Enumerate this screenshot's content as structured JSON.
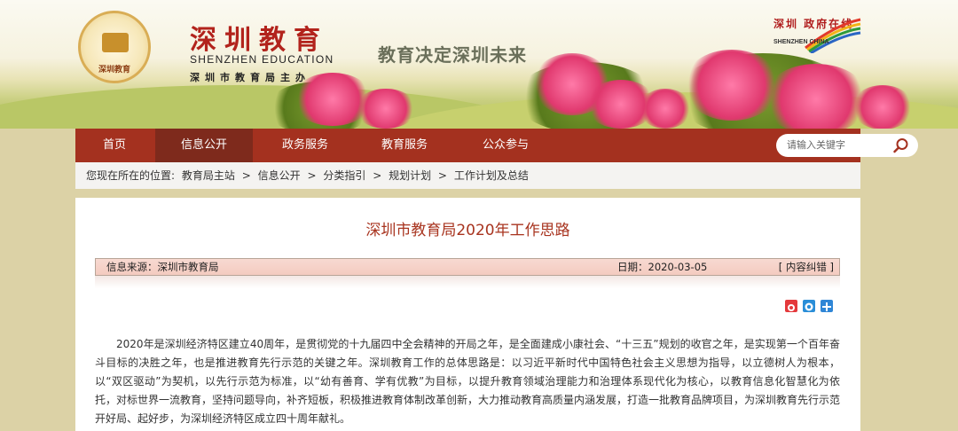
{
  "header": {
    "seal_text": "深圳教育",
    "brand_cn": "深圳教育",
    "brand_en": "SHENZHEN EDUCATION",
    "brand_sub": "深圳市教育局主办",
    "slogan": "教育决定深圳未来",
    "china_cn": "深圳 政府在线",
    "china_en": "SHENZHEN CHINA"
  },
  "nav": {
    "items": [
      {
        "label": "首页",
        "active": false
      },
      {
        "label": "信息公开",
        "active": true
      },
      {
        "label": "政务服务",
        "active": false
      },
      {
        "label": "教育服务",
        "active": false
      },
      {
        "label": "公众参与",
        "active": false
      }
    ],
    "search_placeholder": "请输入关键字"
  },
  "breadcrumb": {
    "prefix": "您现在所在的位置:",
    "items": [
      "教育局主站",
      "信息公开",
      "分类指引",
      "规划计划",
      "工作计划及总结"
    ],
    "separator": ">"
  },
  "article": {
    "title": "深圳市教育局2020年工作思路",
    "source": "信息来源：深圳市教育局",
    "date": "日期：2020-03-05",
    "error_link": "[ 内容纠错 ]",
    "paragraph": "2020年是深圳经济特区建立40周年，是贯彻党的十九届四中全会精神的开局之年，是全面建成小康社会、“十三五”规划的收官之年，是实现第一个百年奋斗目标的决胜之年，也是推进教育先行示范的关键之年。深圳教育工作的总体思路是：以习近平新时代中国特色社会主义思想为指导，以立德树人为根本，以“双区驱动”为契机，以先行示范为标准，以“幼有善育、学有优教”为目标，以提升教育领域治理能力和治理体系现代化为核心，以教育信息化智慧化为依托，对标世界一流教育，坚持问题导向，补齐短板，积极推进教育体制改革创新，大力推动教育高质量内涵发展，打造一批教育品牌项目，为深圳教育先行示范开好局、起好步，为深圳经济特区成立四十周年献礼。"
  },
  "tools": [
    "weibo-icon",
    "qzone-icon",
    "add-share-icon"
  ],
  "colors": {
    "nav": "#a4311f",
    "nav_active": "#7e2a1c",
    "title": "#a8341f",
    "brand": "#b2231c"
  }
}
